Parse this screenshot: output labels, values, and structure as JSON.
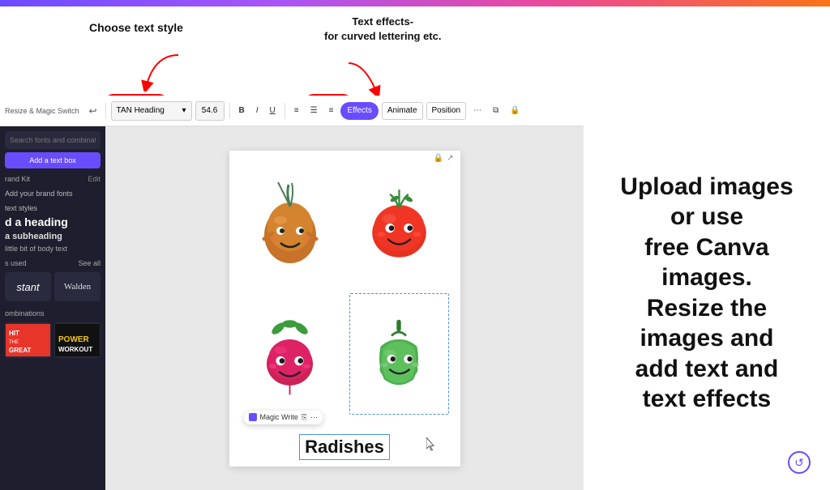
{
  "topBar": {
    "gradient": "linear-gradient(90deg, #6a4cff, #a855f7, #ec4899, #f97316)"
  },
  "annotations": {
    "chooseTextStyle": "Choose text style",
    "textEffectsLine1": "Text effects-",
    "textEffectsLine2": "for curved lettering etc."
  },
  "toolbar": {
    "brand": "Resize & Magic Switch",
    "undoLabel": "↩",
    "fontName": "TAN Heading",
    "fontSize": "54.6",
    "boldLabel": "B",
    "italicLabel": "I",
    "underlineLabel": "U",
    "effectsLabel": "Effects",
    "animateLabel": "Animate",
    "positionLabel": "Position"
  },
  "sidebar": {
    "searchPlaceholder": "Search fonts and combinations",
    "addTextBtnLabel": "Add a text box",
    "brandKitLabel": "rand Kit",
    "editLabel": "Edit",
    "addBrandFontsLabel": "Add your brand fonts",
    "textStylesLabel": "text styles",
    "headingLabel": "d a heading",
    "subheadingLabel": "a subheading",
    "bodyLabel": "little bit of body text",
    "recentlyUsedLabel": "s used",
    "seeAllLabel": "See all",
    "font1Label": "stant",
    "font2Label": "Walden",
    "combinationsLabel": "ombinations"
  },
  "canvas": {
    "vegImages": [
      "onion",
      "tomato",
      "radish",
      "bell-pepper"
    ],
    "radishesText": "Radishes",
    "magicWriteLabel": "Magic Write"
  },
  "rightAnnotation": {
    "line1": "Upload images",
    "line2": "or use",
    "line3": "free Canva",
    "line4": "images.",
    "line5": "Resize the",
    "line6": "images and",
    "line7": "add text and",
    "line8": "text effects"
  }
}
